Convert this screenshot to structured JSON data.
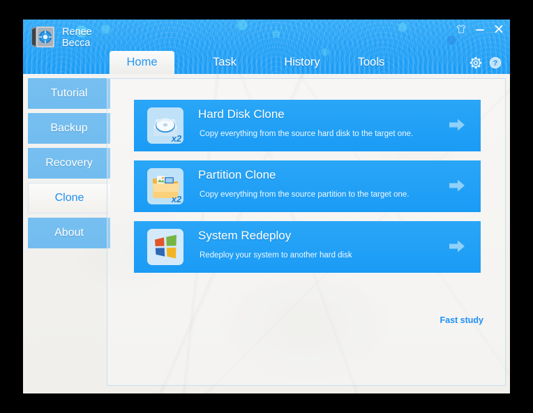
{
  "window": {
    "brand_line1": "Renee",
    "brand_line2": "Becca",
    "logo_icon": "safe-vault-icon",
    "controls": [
      {
        "name": "skin-icon",
        "glyph": "☂"
      },
      {
        "name": "minimize-icon",
        "glyph": "–"
      },
      {
        "name": "close-icon",
        "glyph": "✕"
      }
    ]
  },
  "tabs": [
    {
      "id": "home",
      "label": "Home",
      "active": true
    },
    {
      "id": "task",
      "label": "Task",
      "active": false
    },
    {
      "id": "history",
      "label": "History",
      "active": false
    },
    {
      "id": "tools",
      "label": "Tools",
      "active": false
    }
  ],
  "tab_icons": [
    {
      "name": "gear-icon",
      "label": "Settings"
    },
    {
      "name": "help-icon",
      "label": "Help"
    }
  ],
  "sidebar": {
    "items": [
      {
        "label": "Tutorial",
        "active": false
      },
      {
        "label": "Backup",
        "active": false
      },
      {
        "label": "Recovery",
        "active": false
      },
      {
        "label": "Clone",
        "active": true
      },
      {
        "label": "About",
        "active": false
      }
    ]
  },
  "main": {
    "cards": [
      {
        "title": "Hard Disk Clone",
        "desc": "Copy everything from the source hard disk to the target one.",
        "icon": "hard-disk-icon",
        "badge": "x2",
        "arrow": "arrow-right-icon"
      },
      {
        "title": "Partition Clone",
        "desc": "Copy everything from the source partition to the target one.",
        "icon": "folder-partition-icon",
        "badge": "x2",
        "arrow": "arrow-right-icon"
      },
      {
        "title": "System Redeploy",
        "desc": "Redeploy your system to another hard disk",
        "icon": "windows-logo-icon",
        "badge": "",
        "arrow": "arrow-right-icon"
      }
    ],
    "fast_study_label": "Fast study"
  },
  "colors": {
    "header_blue": "#21a0f6",
    "card_blue": "#1a9bf5",
    "sidebar_blue": "#74bdef",
    "accent_link": "#1e90f5",
    "active_tab_text": "#2196f3",
    "panel_bg": "#f3f2ef"
  }
}
